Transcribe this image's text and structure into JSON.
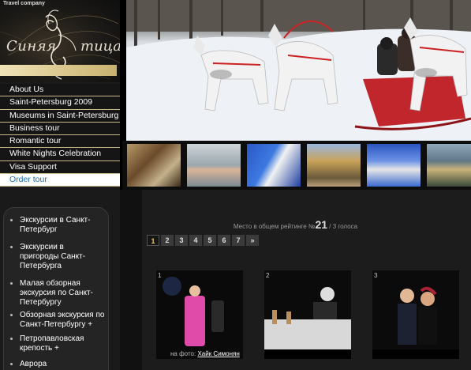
{
  "brand": {
    "tagline": "Travel company",
    "logo_word1": "Синяя",
    "logo_word2": "тица"
  },
  "menu": [
    {
      "label": "About Us",
      "active": false
    },
    {
      "label": "Saint-Petersburg 2009",
      "active": false
    },
    {
      "label": "Museums in Saint-Petersburg",
      "active": false
    },
    {
      "label": "Business tour",
      "active": false
    },
    {
      "label": "Romantic tour",
      "active": false
    },
    {
      "label": "White Nights Celebration",
      "active": false
    },
    {
      "label": "Visa Support",
      "active": false
    },
    {
      "label": "Order tour",
      "active": true
    }
  ],
  "side_links": [
    {
      "label": "Экскурсии в Санкт-Петербург"
    },
    {
      "label": "Экскурсии в пригороды Санкт-Петербурга"
    },
    {
      "label": "Малая обзорная экскурсия по Санкт-Петербургу"
    },
    {
      "label": "Обзорная экскурсия по Санкт-Петербургу +"
    },
    {
      "label": "Петропавловская крепость +"
    },
    {
      "label": "Аврора"
    }
  ],
  "rating": {
    "prefix": "Место в общем рейтинге №",
    "number": "21",
    "suffix": "/ 3 голоса"
  },
  "pager": {
    "pages": [
      "1",
      "2",
      "3",
      "4",
      "5",
      "6",
      "7"
    ],
    "current": "1",
    "next": "»"
  },
  "photos": [
    {
      "num": "1"
    },
    {
      "num": "2"
    },
    {
      "num": "3"
    }
  ],
  "caption": {
    "prefix": "на фото:",
    "name": "Хайк Симонян"
  },
  "colors": {
    "accent_gold": "#d9c58a",
    "active_menu_text": "#1e6fb5",
    "pager_current": "#e2c766"
  }
}
